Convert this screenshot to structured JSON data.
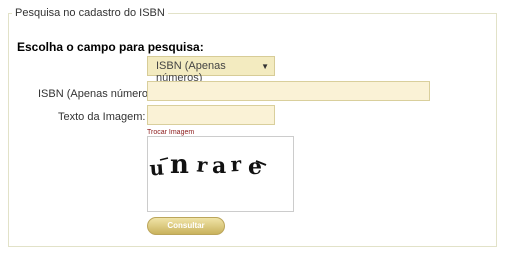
{
  "form": {
    "legend": "Pesquisa no cadastro do ISBN",
    "heading": "Escolha o campo para pesquisa:",
    "search_field": {
      "selected": "ISBN (Apenas números)"
    },
    "isbn_label": "ISBN (Apenas números):",
    "isbn_value": "",
    "image_text_label": "Texto da Imagem:",
    "image_text_value": "",
    "change_image_link": "Trocar Imagem",
    "captcha_text": "unrare",
    "submit_label": "Consultar"
  },
  "colors": {
    "input_bg": "#faf2d6",
    "select_bg": "#f3ebc0",
    "button_gold": "#c9b25d",
    "link_red": "#8b1a1a"
  },
  "icons": {
    "select_arrow": "chevron-down-icon"
  }
}
